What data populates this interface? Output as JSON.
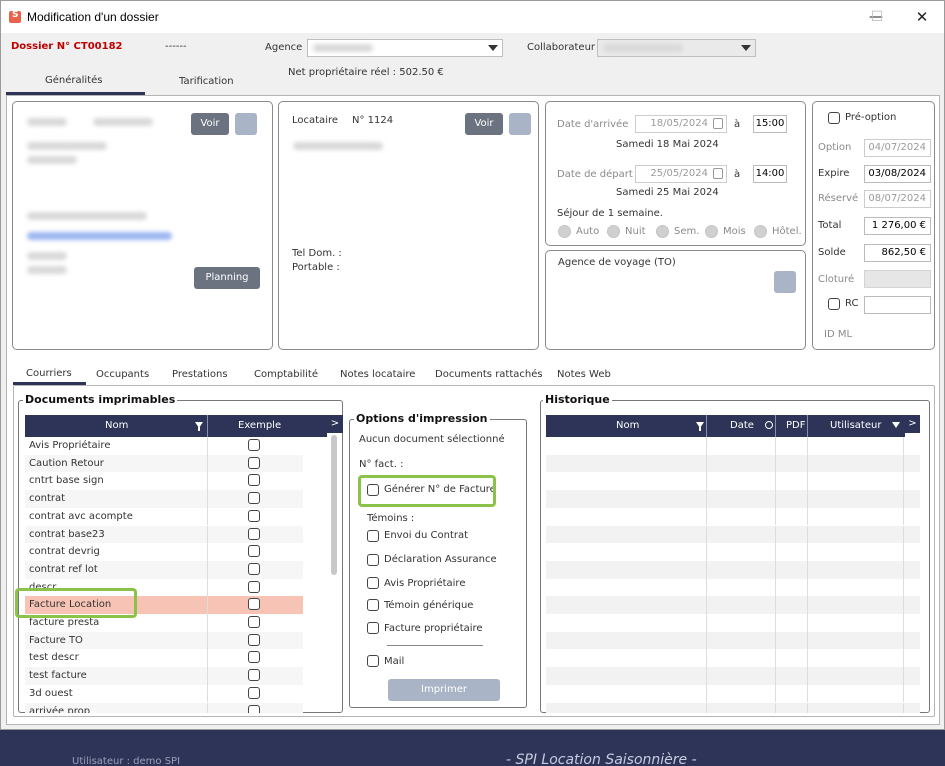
{
  "window": {
    "title": "Modification d'un dossier",
    "min": "—",
    "max": "☐",
    "close": "✕"
  },
  "header": {
    "dossier_label": "Dossier N° CT00182",
    "dashes": "------",
    "agence_label": "Agence",
    "collab_label": "Collaborateur",
    "net_proprio": "Net propriétaire réel : 502.50 €"
  },
  "tabs": [
    "Généralités",
    "Tarification"
  ],
  "left_panel": {
    "voir": "Voir",
    "planning": "Planning"
  },
  "locataire": {
    "label": "Locataire",
    "num": "N° 1124",
    "voir": "Voir",
    "tel": "Tel Dom. :",
    "portable": "Portable :"
  },
  "dates": {
    "arrivee_label": "Date d'arrivée",
    "arrivee": "18/05/2024",
    "a1": "à",
    "arrivee_time": "15:00",
    "arrivee_text": "Samedi 18 Mai 2024",
    "depart_label": "Date de départ",
    "depart": "25/05/2024",
    "a2": "à",
    "depart_time": "14:00",
    "depart_text": "Samedi 25 Mai 2024",
    "sejour": "Séjour de 1 semaine.",
    "radios": [
      "Auto",
      "Nuit",
      "Sem.",
      "Mois",
      "Hôtel."
    ]
  },
  "agence_voyage": {
    "label": "Agence de voyage (TO)"
  },
  "right": {
    "preoption": "Pré-option",
    "option_label": "Option",
    "option": "04/07/2024",
    "expire_label": "Expire",
    "expire": "03/08/2024",
    "reserve_label": "Réservé",
    "reserve": "08/07/2024",
    "total_label": "Total",
    "total": "1 276,00 €",
    "solde_label": "Solde",
    "solde": "862,50 €",
    "cloture_label": "Cloturé",
    "rc_label": "RC",
    "idml_label": "ID ML"
  },
  "subtabs": [
    "Courriers",
    "Occupants",
    "Prestations",
    "Comptabilité",
    "Notes locataire",
    "Documents rattachés",
    "Notes Web"
  ],
  "docs": {
    "title": "Documents imprimables",
    "col_nom": "Nom",
    "col_exemple": "Exemple",
    "arrow": ">",
    "items": [
      "Avis Propriétaire",
      "Caution Retour",
      "cntrt base sign",
      "contrat",
      "contrat avc acompte",
      "contrat base23",
      "contrat devrig",
      "contrat ref lot",
      "descr",
      "Facture Location",
      "facture presta",
      "Facture TO",
      "test descr",
      "test facture",
      "3d ouest",
      "arrivée prop"
    ],
    "selected_index": 9
  },
  "options": {
    "title": "Options d'impression",
    "none": "Aucun document sélectionné",
    "nfact": "N° fact. :",
    "generer": "Générer N° de Facture",
    "temoins": "Témoins :",
    "checks": [
      "Envoi du Contrat",
      "Déclaration Assurance",
      "Avis Propriétaire",
      "Témoin générique",
      "Facture propriétaire"
    ],
    "mail": "Mail",
    "imprimer": "Imprimer"
  },
  "historique": {
    "title": "Historique",
    "col_nom": "Nom",
    "col_date": "Date",
    "col_pdf": "PDF",
    "col_user": "Utilisateur",
    "arrow": ">"
  },
  "footer": {
    "user": "Utilisateur : demo SPI",
    "app": "- SPI Location Saisonnière -"
  },
  "colors": {
    "accent": "#2d3458",
    "dossier": "#c00000",
    "selected_row": "#f7c3b5",
    "highlight": "#8bc34a"
  }
}
